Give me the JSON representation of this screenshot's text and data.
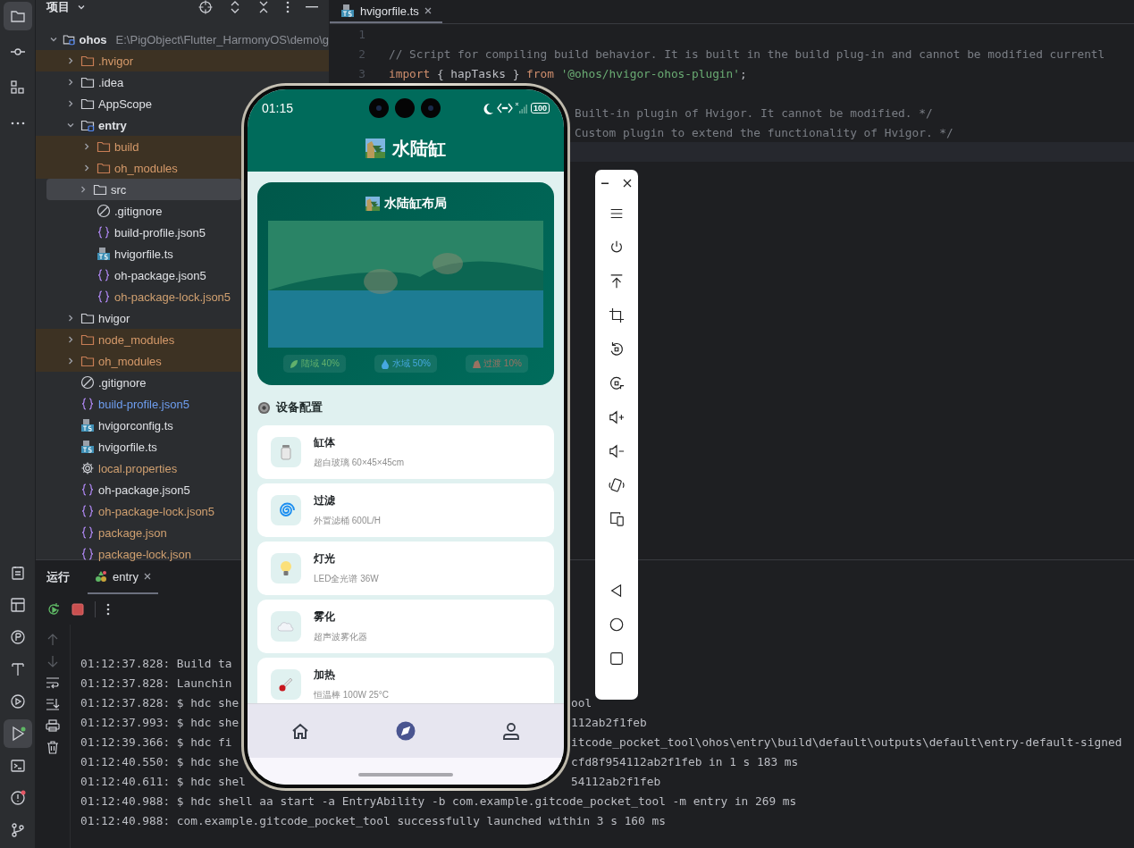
{
  "sidebar": {
    "top": [
      {
        "kind": "project",
        "selected": true
      },
      {
        "kind": "commit",
        "selected": false
      },
      {
        "kind": "structure",
        "selected": false
      },
      {
        "kind": "more",
        "selected": false
      }
    ],
    "bottom": [
      {
        "kind": "todo",
        "selected": false
      },
      {
        "kind": "layout",
        "selected": false
      },
      {
        "kind": "profiler",
        "selected": false
      },
      {
        "kind": "build",
        "selected": false
      },
      {
        "kind": "services",
        "selected": false
      },
      {
        "kind": "run",
        "selected": true
      },
      {
        "kind": "terminal",
        "selected": false
      },
      {
        "kind": "problems",
        "selected": false
      },
      {
        "kind": "git",
        "selected": false
      }
    ]
  },
  "project_panel": {
    "title": "项目",
    "tree": [
      {
        "name": "ohos",
        "path": "E:\\PigObject\\Flutter_HarmonyOS\\demo\\g",
        "kind": "module",
        "excluded": false,
        "color": "#dfe1e5",
        "expanded": true,
        "selected": false,
        "children": [
          {
            "name": ".hvigor",
            "kind": "folder",
            "excluded": true,
            "color": "#d69a6a",
            "expanded": false,
            "selected": false
          },
          {
            "name": ".idea",
            "kind": "folder",
            "excluded": false,
            "color": "#dfe1e5",
            "expanded": false,
            "selected": false
          },
          {
            "name": "AppScope",
            "kind": "folder",
            "excluded": false,
            "color": "#dfe1e5",
            "expanded": false,
            "selected": false
          },
          {
            "name": "entry",
            "kind": "module",
            "excluded": false,
            "color": "#dfe1e5",
            "expanded": true,
            "selected": false,
            "children": [
              {
                "name": "build",
                "kind": "folder",
                "excluded": true,
                "color": "#d69a6a",
                "expanded": false,
                "selected": false
              },
              {
                "name": "oh_modules",
                "kind": "folder",
                "excluded": true,
                "color": "#d69a6a",
                "expanded": false,
                "selected": false
              },
              {
                "name": "src",
                "kind": "folder",
                "excluded": false,
                "color": "#dfe1e5",
                "expanded": false,
                "selected": true
              },
              {
                "name": ".gitignore",
                "kind": "ignore",
                "excluded": false,
                "color": "#dfe1e5",
                "selected": false
              },
              {
                "name": "build-profile.json5",
                "kind": "json",
                "excluded": false,
                "color": "#dfe1e5",
                "selected": false
              },
              {
                "name": "hvigorfile.ts",
                "kind": "ts",
                "excluded": false,
                "color": "#dfe1e5",
                "selected": false
              },
              {
                "name": "oh-package.json5",
                "kind": "json",
                "excluded": false,
                "color": "#dfe1e5",
                "selected": false
              },
              {
                "name": "oh-package-lock.json5",
                "kind": "json",
                "excluded": false,
                "color": "#d0a070",
                "selected": false
              }
            ]
          },
          {
            "name": "hvigor",
            "kind": "folder",
            "excluded": false,
            "color": "#dfe1e5",
            "expanded": false,
            "selected": false
          },
          {
            "name": "node_modules",
            "kind": "folder",
            "excluded": true,
            "color": "#d69a6a",
            "expanded": false,
            "selected": false
          },
          {
            "name": "oh_modules",
            "kind": "folder",
            "excluded": true,
            "color": "#d69a6a",
            "expanded": false,
            "selected": false
          },
          {
            "name": ".gitignore",
            "kind": "ignore",
            "excluded": false,
            "color": "#dfe1e5",
            "selected": false
          },
          {
            "name": "build-profile.json5",
            "kind": "json",
            "excluded": false,
            "color": "#6e9ef0",
            "selected": false
          },
          {
            "name": "hvigorconfig.ts",
            "kind": "ts",
            "excluded": false,
            "color": "#dfe1e5",
            "selected": false
          },
          {
            "name": "hvigorfile.ts",
            "kind": "ts",
            "excluded": false,
            "color": "#dfe1e5",
            "selected": false
          },
          {
            "name": "local.properties",
            "kind": "props",
            "excluded": false,
            "color": "#d0a070",
            "selected": false
          },
          {
            "name": "oh-package.json5",
            "kind": "json",
            "excluded": false,
            "color": "#dfe1e5",
            "selected": false
          },
          {
            "name": "oh-package-lock.json5",
            "kind": "json",
            "excluded": false,
            "color": "#d0a070",
            "selected": false
          },
          {
            "name": "package.json",
            "kind": "json",
            "excluded": false,
            "color": "#d0a070",
            "selected": false
          },
          {
            "name": "package-lock.json",
            "kind": "json",
            "excluded": false,
            "color": "#d0a070",
            "selected": false
          }
        ]
      }
    ]
  },
  "editor": {
    "tabs": [
      {
        "label": "hvigorfile.ts",
        "selected": true
      }
    ],
    "lines": [
      {
        "number": "1",
        "kind": "full",
        "current": false
      },
      {
        "number": "2",
        "kind": "full",
        "current": false,
        "tokens": [
          {
            "kind": "comment",
            "text": "// Script for compiling build behavior. It is built in the build plug-in and cannot be modified currentl"
          }
        ]
      },
      {
        "number": "3",
        "kind": "full",
        "current": false,
        "tokens": [
          {
            "kind": "keyword",
            "text": "import"
          },
          {
            "kind": "plain",
            "text": " { hapTasks } "
          },
          {
            "kind": "keyword",
            "text": "from"
          },
          {
            "kind": "string",
            "text": " '@ohos/hvigor-ohos-plugin'"
          },
          {
            "kind": "plain",
            "text": ";"
          }
        ]
      },
      {
        "kind": "tail",
        "current": false
      },
      {
        "kind": "tail",
        "current": false,
        "tokens": [
          {
            "kind": "comment",
            "text": "Built-in plugin of Hvigor. It cannot be modified. */"
          }
        ]
      },
      {
        "kind": "tail",
        "current": false,
        "tokens": [
          {
            "kind": "comment",
            "text": "Custom plugin to extend the functionality of Hvigor. */"
          }
        ]
      },
      {
        "kind": "tail",
        "current": true
      }
    ]
  },
  "run_panel": {
    "title": "运行",
    "tabs": [
      {
        "label": "entry",
        "selected": true
      }
    ],
    "console": [
      {
        "text": "01:12:37.828: Build ta"
      },
      {
        "text": "01:12:37.828: Launchin"
      },
      {
        "text": "01:12:37.828: $ hdc she",
        "tail": "ool"
      },
      {
        "text": "01:12:37.993: $ hdc she",
        "tail": "112ab2f1feb"
      },
      {
        "text": "01:12:39.366: $ hdc fi",
        "tail": "itcode_pocket_tool\\ohos\\entry\\build\\default\\outputs\\default\\entry-default-signed"
      },
      {
        "text": "01:12:40.550: $ hdc she",
        "tail": "cfd8f954112ab2f1feb in 1 s 183 ms"
      },
      {
        "text": "01:12:40.611: $ hdc shel",
        "tail": "54112ab2f1feb"
      },
      {
        "text": "01:12:40.988: $ hdc shell aa start -a EntryAbility -b com.example.gitcode_pocket_tool -m entry in 269 ms"
      },
      {
        "text": "01:12:40.988: com.example.gitcode_pocket_tool successfully launched within 3 s 160 ms"
      }
    ]
  },
  "phone": {
    "status_bar": {
      "time": "01:15",
      "battery": "100"
    },
    "header": {
      "title": "水陆缸"
    },
    "layout_card": {
      "title": "水陆缸布局",
      "legend": [
        {
          "kind": "land",
          "label": "陆域 40%",
          "color": "#62b06c"
        },
        {
          "kind": "water",
          "label": "水域 50%",
          "color": "#46a8e0"
        },
        {
          "kind": "transition",
          "label": "过渡 10%",
          "color": "#9a7262"
        }
      ]
    },
    "section": {
      "title": "设备配置"
    },
    "devices": [
      {
        "kind": "tank",
        "name": "缸体",
        "spec": "超白玻璃 60×45×45cm"
      },
      {
        "kind": "filter",
        "name": "过滤",
        "spec": "外置滤桶 600L/H"
      },
      {
        "kind": "light",
        "name": "灯光",
        "spec": "LED全光谱 36W"
      },
      {
        "kind": "mist",
        "name": "雾化",
        "spec": "超声波雾化器"
      },
      {
        "kind": "heater",
        "name": "加热",
        "spec": "恒温棒 100W 25°C"
      }
    ],
    "nav": [
      {
        "kind": "home",
        "selected": false
      },
      {
        "kind": "discover",
        "selected": true
      },
      {
        "kind": "profile",
        "selected": false
      }
    ]
  }
}
